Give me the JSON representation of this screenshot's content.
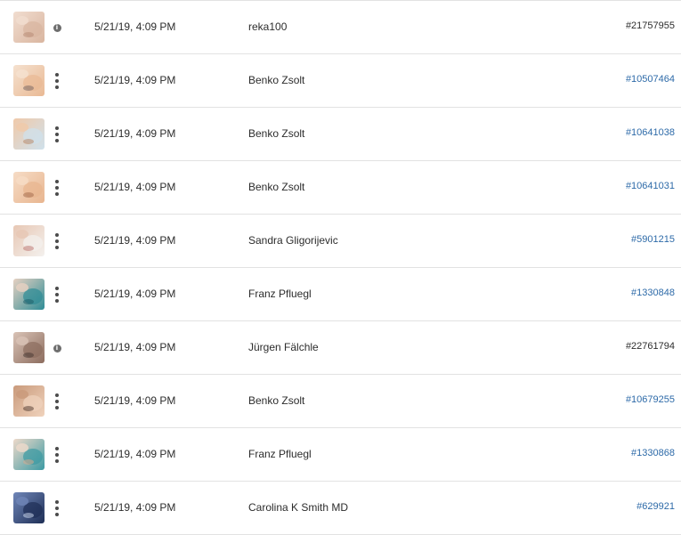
{
  "rows": [
    {
      "thumb_icon": "skin-photo-thumbnail",
      "action_icon": "info-icon",
      "date": "5/21/19, 4:09 PM",
      "author": "reka100",
      "id": "#21757955",
      "linked": false,
      "thumb_colors": [
        "#d9b59f",
        "#f1ddd0",
        "#b88d77"
      ]
    },
    {
      "thumb_icon": "face-treatment-thumbnail",
      "action_icon": "more-vertical-icon",
      "date": "5/21/19, 4:09 PM",
      "author": "Benko Zsolt",
      "id": "#10507464",
      "linked": true,
      "thumb_colors": [
        "#e9b994",
        "#f5e1cf",
        "#7c6a66"
      ]
    },
    {
      "thumb_icon": "face-treatment-thumbnail",
      "action_icon": "more-vertical-icon",
      "date": "5/21/19, 4:09 PM",
      "author": "Benko Zsolt",
      "id": "#10641038",
      "linked": true,
      "thumb_colors": [
        "#cfe1ec",
        "#f0c9a9",
        "#b98a6a"
      ]
    },
    {
      "thumb_icon": "skin-closeup-thumbnail",
      "action_icon": "more-vertical-icon",
      "date": "5/21/19, 4:09 PM",
      "author": "Benko Zsolt",
      "id": "#10641031",
      "linked": true,
      "thumb_colors": [
        "#e8b58f",
        "#f6dcc6",
        "#a66e4f"
      ]
    },
    {
      "thumb_icon": "woman-face-thumbnail",
      "action_icon": "more-vertical-icon",
      "date": "5/21/19, 4:09 PM",
      "author": "Sandra Gligorijevic",
      "id": "#5901215",
      "linked": true,
      "thumb_colors": [
        "#f4f1ee",
        "#e7c7b4",
        "#c07b77"
      ]
    },
    {
      "thumb_icon": "spa-treatment-thumbnail",
      "action_icon": "more-vertical-icon",
      "date": "5/21/19, 4:09 PM",
      "author": "Franz Pfluegl",
      "id": "#1330848",
      "linked": true,
      "thumb_colors": [
        "#2e8c96",
        "#e7d1c2",
        "#1f5f6a"
      ]
    },
    {
      "thumb_icon": "face-closeup-thumbnail",
      "action_icon": "info-icon",
      "date": "5/21/19, 4:09 PM",
      "author": "Jürgen Fälchle",
      "id": "#22761794",
      "linked": false,
      "thumb_colors": [
        "#8c6c5e",
        "#d9c3b6",
        "#4a3a35"
      ]
    },
    {
      "thumb_icon": "eye-closeup-thumbnail",
      "action_icon": "more-vertical-icon",
      "date": "5/21/19, 4:09 PM",
      "author": "Benko Zsolt",
      "id": "#10679255",
      "linked": true,
      "thumb_colors": [
        "#f0d3bd",
        "#c99a7b",
        "#5b4338"
      ]
    },
    {
      "thumb_icon": "spa-treatment-thumbnail",
      "action_icon": "more-vertical-icon",
      "date": "5/21/19, 4:09 PM",
      "author": "Franz Pfluegl",
      "id": "#1330868",
      "linked": true,
      "thumb_colors": [
        "#3c9aa3",
        "#eed9ca",
        "#d6a98e"
      ]
    },
    {
      "thumb_icon": "clinic-thumbnail",
      "action_icon": "more-vertical-icon",
      "date": "5/21/19, 4:09 PM",
      "author": "Carolina K Smith MD",
      "id": "#629921",
      "linked": true,
      "thumb_colors": [
        "#1e2e55",
        "#6f86b8",
        "#c6d3ea"
      ]
    }
  ],
  "colors": {
    "text": "#2c2c2c",
    "link": "#2d6aa8",
    "divider": "#e2e2e2",
    "icon": "#4b4b4b"
  }
}
